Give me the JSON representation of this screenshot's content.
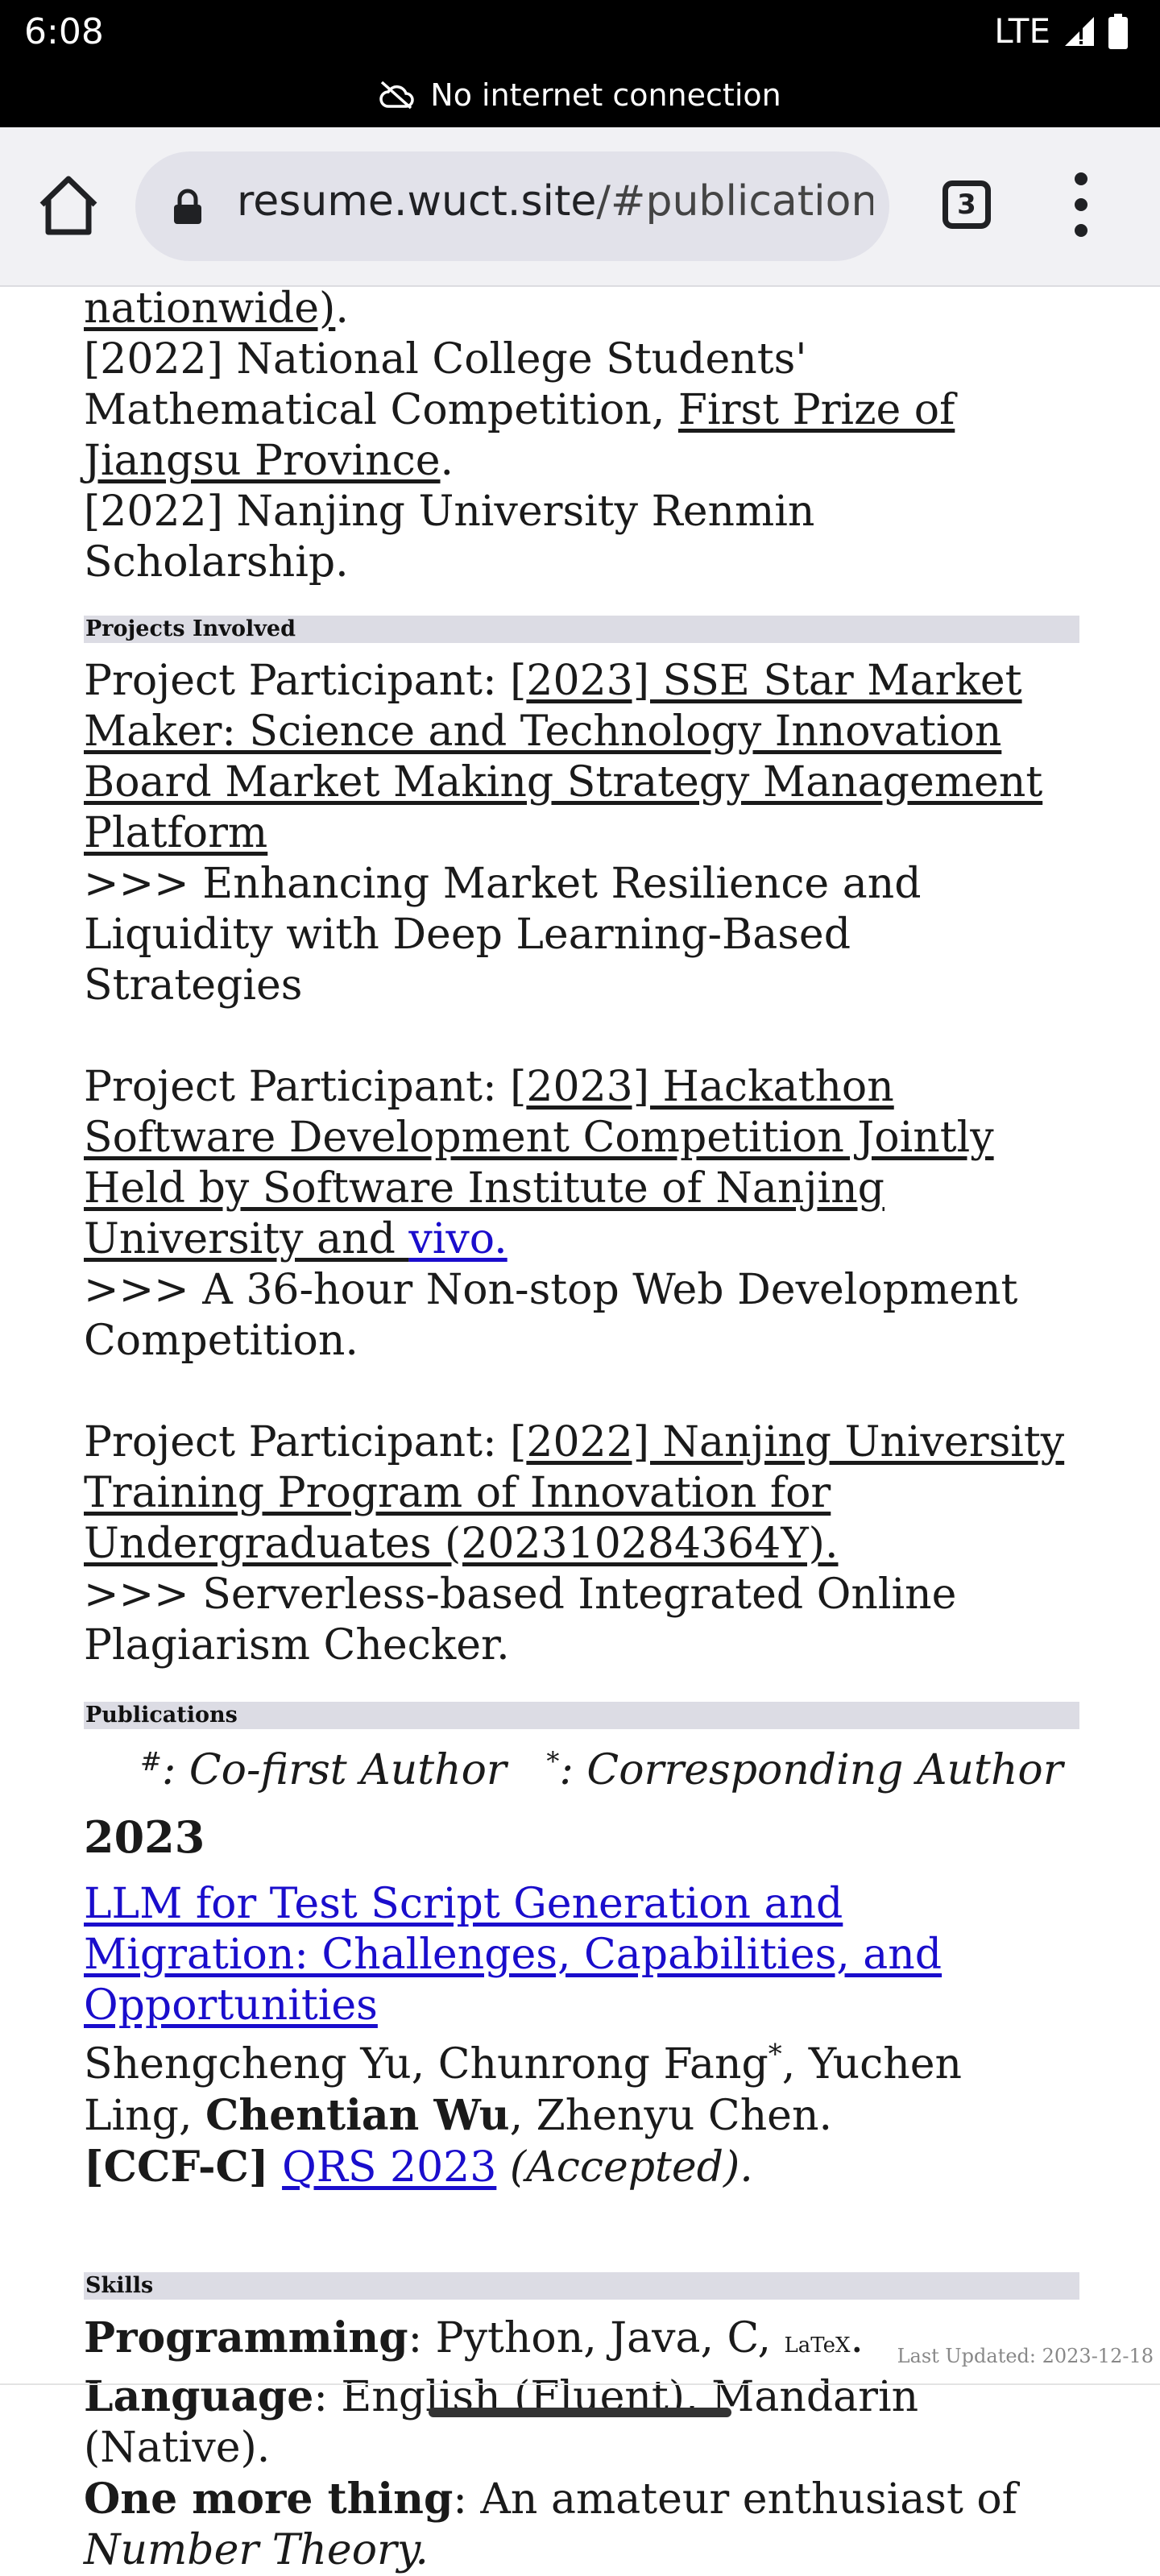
{
  "status_bar": {
    "time": "6:08",
    "network": "LTE",
    "offline_text": "No internet connection"
  },
  "browser": {
    "url_domain": "resume.wuct.site",
    "url_path": "/#publications",
    "tab_count": "3"
  },
  "awards_tail": {
    "line0_link": "nationwide)",
    "line0_suffix": ".",
    "item1_prefix": "[2022] National College Students' Mathematical Competition, ",
    "item1_link": "First Prize of Jiangsu Province",
    "item1_suffix": ".",
    "item2": "[2022] Nanjing University Renmin Scholarship."
  },
  "projects": {
    "heading": "Projects Involved",
    "items": [
      {
        "prefix": "Project Participant: [",
        "link": "2023] SSE Star Market Maker: Science and Technology Innovation Board Market Making Strategy Management Platform",
        "desc": " >>> Enhancing Market Resilience and Liquidity with Deep Learning-Based Strategies"
      },
      {
        "prefix": "Project Participant: [",
        "link": "2023] Hackathon Software Development Competition Jointly Held by Software Institute of Nanjing University and ",
        "link_blue": "vivo.",
        "desc": " >>> A 36-hour Non-stop Web Development Competition."
      },
      {
        "prefix": "Project Participant: [",
        "link": "2022] Nanjing University Training Program of Innovation for Undergraduates (202310284364Y).",
        "desc": " >>> Serverless-based Integrated Online Plagiarism Checker."
      }
    ]
  },
  "publications": {
    "heading": "Publications",
    "legend_hash": "#",
    "legend_first": ": Co-first Author",
    "legend_star": "*",
    "legend_corr": ": Corresponding Author",
    "year": "2023",
    "paper_title": "LLM for Test Script Generation and Migration: Challenges, Capabilities, and Opportunities",
    "authors_a": "Shengcheng Yu, Chunrong Fang",
    "authors_star": "*",
    "authors_b": ", Yuchen Ling,",
    "author_bold": "Chentian Wu",
    "authors_c": ", Zhenyu Chen.",
    "venue_tag": "[CCF-C]",
    "venue_link": "QRS 2023",
    "venue_status": "(Accepted)."
  },
  "skills": {
    "heading": "Skills",
    "prog_label": "Programming",
    "prog_value": ": Python, Java, C, ",
    "prog_latex": "LaTeX",
    "prog_end": ".",
    "lang_label": "Language",
    "lang_value": ": English (Fluent), Mandarin (Native).",
    "more_label": "One more thing",
    "more_value": ": An amateur enthusiast of ",
    "more_italic": "Number Theory."
  },
  "footer": {
    "last_updated": "Last Updated: 2023-12-18"
  },
  "colors": {
    "status_bar_bg": "#000000",
    "toolbar_bg": "#f1f1f4",
    "section_bar": "#dcdce4",
    "link_blue": "#1a0dcc"
  }
}
